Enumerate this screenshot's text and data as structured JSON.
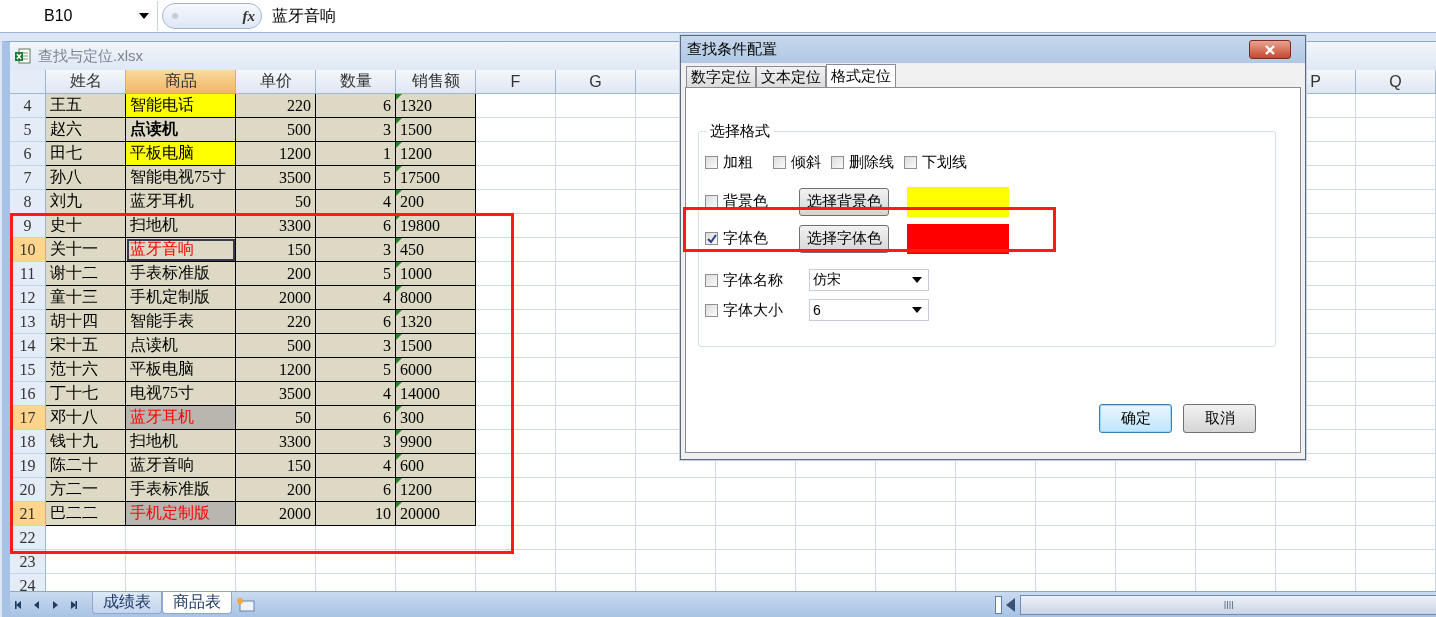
{
  "formula_bar": {
    "cell_ref": "B10",
    "function_label": "fx",
    "value": "蓝牙音响"
  },
  "workbook": {
    "title": "查找与定位.xlsx",
    "columns": [
      {
        "label": "姓名",
        "selected": false
      },
      {
        "label": "商品",
        "selected": true
      },
      {
        "label": "单价",
        "selected": false
      },
      {
        "label": "数量",
        "selected": false
      },
      {
        "label": "销售额",
        "selected": false
      },
      {
        "label": "F",
        "selected": false
      },
      {
        "label": "G",
        "selected": false
      }
    ],
    "far_columns": [
      {
        "label": "P",
        "selected": false
      },
      {
        "label": "Q",
        "selected": false
      }
    ],
    "rows": [
      {
        "row": "4",
        "selected": false,
        "name": "王五",
        "product": "智能电话",
        "color": "#ffff00",
        "bold": false,
        "red_text": false,
        "active": false,
        "price": "220",
        "qty": "6",
        "sales": "1320",
        "flagged": true
      },
      {
        "row": "5",
        "selected": false,
        "name": "赵六",
        "product": "点读机",
        "color": "#ddd9c4",
        "bold": true,
        "red_text": false,
        "active": false,
        "price": "500",
        "qty": "3",
        "sales": "1500",
        "flagged": true
      },
      {
        "row": "6",
        "selected": false,
        "name": "田七",
        "product": "平板电脑",
        "color": "#ffff00",
        "bold": false,
        "red_text": false,
        "active": false,
        "price": "1200",
        "qty": "1",
        "sales": "1200",
        "flagged": true
      },
      {
        "row": "7",
        "selected": false,
        "name": "孙八",
        "product": "智能电视75寸",
        "color": "#ddd9c4",
        "bold": false,
        "red_text": false,
        "active": false,
        "price": "3500",
        "qty": "5",
        "sales": "17500",
        "flagged": true
      },
      {
        "row": "8",
        "selected": false,
        "name": "刘九",
        "product": "蓝牙耳机",
        "color": "#ddd9c4",
        "bold": false,
        "red_text": false,
        "active": false,
        "price": "50",
        "qty": "4",
        "sales": "200",
        "flagged": true
      },
      {
        "row": "9",
        "selected": false,
        "name": "史十",
        "product": "扫地机",
        "color": "#ddd9c4",
        "bold": false,
        "red_text": false,
        "active": false,
        "price": "3300",
        "qty": "6",
        "sales": "19800",
        "flagged": true
      },
      {
        "row": "10",
        "selected": true,
        "name": "关十一",
        "product": "蓝牙音响",
        "color": "#ddd9c4",
        "bold": false,
        "red_text": true,
        "active": true,
        "price": "150",
        "qty": "3",
        "sales": "450",
        "flagged": true
      },
      {
        "row": "11",
        "selected": false,
        "name": "谢十二",
        "product": "手表标准版",
        "color": "#ddd9c4",
        "bold": false,
        "red_text": false,
        "active": false,
        "price": "200",
        "qty": "5",
        "sales": "1000",
        "flagged": true
      },
      {
        "row": "12",
        "selected": false,
        "name": "童十三",
        "product": "手机定制版",
        "color": "#ddd9c4",
        "bold": false,
        "red_text": false,
        "active": false,
        "price": "2000",
        "qty": "4",
        "sales": "8000",
        "flagged": true
      },
      {
        "row": "13",
        "selected": false,
        "name": "胡十四",
        "product": "智能手表",
        "color": "#ddd9c4",
        "bold": false,
        "red_text": false,
        "active": false,
        "price": "220",
        "qty": "6",
        "sales": "1320",
        "flagged": true
      },
      {
        "row": "14",
        "selected": false,
        "name": "宋十五",
        "product": "点读机",
        "color": "#ddd9c4",
        "bold": false,
        "red_text": false,
        "active": false,
        "price": "500",
        "qty": "3",
        "sales": "1500",
        "flagged": true
      },
      {
        "row": "15",
        "selected": false,
        "name": "范十六",
        "product": "平板电脑",
        "color": "#ddd9c4",
        "bold": false,
        "red_text": false,
        "active": false,
        "price": "1200",
        "qty": "5",
        "sales": "6000",
        "flagged": true
      },
      {
        "row": "16",
        "selected": false,
        "name": "丁十七",
        "product": "电视75寸",
        "color": "#ddd9c4",
        "bold": false,
        "red_text": false,
        "active": false,
        "price": "3500",
        "qty": "4",
        "sales": "14000",
        "flagged": true
      },
      {
        "row": "17",
        "selected": true,
        "name": "邓十八",
        "product": "蓝牙耳机",
        "color": "#b8b6ae",
        "bold": false,
        "red_text": true,
        "active": false,
        "price": "50",
        "qty": "6",
        "sales": "300",
        "flagged": true
      },
      {
        "row": "18",
        "selected": false,
        "name": "钱十九",
        "product": "扫地机",
        "color": "#ddd9c4",
        "bold": false,
        "red_text": false,
        "active": false,
        "price": "3300",
        "qty": "3",
        "sales": "9900",
        "flagged": true
      },
      {
        "row": "19",
        "selected": false,
        "name": "陈二十",
        "product": "蓝牙音响",
        "color": "#ddd9c4",
        "bold": false,
        "red_text": false,
        "active": false,
        "price": "150",
        "qty": "4",
        "sales": "600",
        "flagged": true
      },
      {
        "row": "20",
        "selected": false,
        "name": "方二一",
        "product": "手表标准版",
        "color": "#ddd9c4",
        "bold": false,
        "red_text": false,
        "active": false,
        "price": "200",
        "qty": "6",
        "sales": "1200",
        "flagged": true
      },
      {
        "row": "21",
        "selected": true,
        "name": "巴二二",
        "product": "手机定制版",
        "color": "#b8b6ae",
        "bold": false,
        "red_text": true,
        "active": false,
        "price": "2000",
        "qty": "10",
        "sales": "20000",
        "flagged": true
      }
    ],
    "empty_rows": [
      "22",
      "23",
      "24"
    ],
    "sheet_tabs": [
      {
        "label": "成绩表",
        "selected": false
      },
      {
        "label": "商品表",
        "selected": true
      }
    ]
  },
  "dialog": {
    "title": "查找条件配置",
    "tabs": [
      {
        "label": "数字定位",
        "selected": false
      },
      {
        "label": "文本定位",
        "selected": false
      },
      {
        "label": "格式定位",
        "selected": true
      }
    ],
    "group_title": "选择格式",
    "style_options": [
      {
        "label": "加粗",
        "checked": false
      },
      {
        "label": "倾斜",
        "checked": false
      },
      {
        "label": "删除线",
        "checked": false
      },
      {
        "label": "下划线",
        "checked": false
      }
    ],
    "color_options": [
      {
        "label": "背景色",
        "checked": false,
        "button": "选择背景色",
        "color": "#ffff00"
      },
      {
        "label": "字体色",
        "checked": true,
        "button": "选择字体色",
        "color": "#ff0000"
      }
    ],
    "font_options": [
      {
        "label": "字体名称",
        "checked": false,
        "value": "仿宋"
      },
      {
        "label": "字体大小",
        "checked": false,
        "value": "6"
      }
    ],
    "buttons": [
      {
        "label": "确定",
        "default": true
      },
      {
        "label": "取消",
        "default": false
      }
    ]
  }
}
